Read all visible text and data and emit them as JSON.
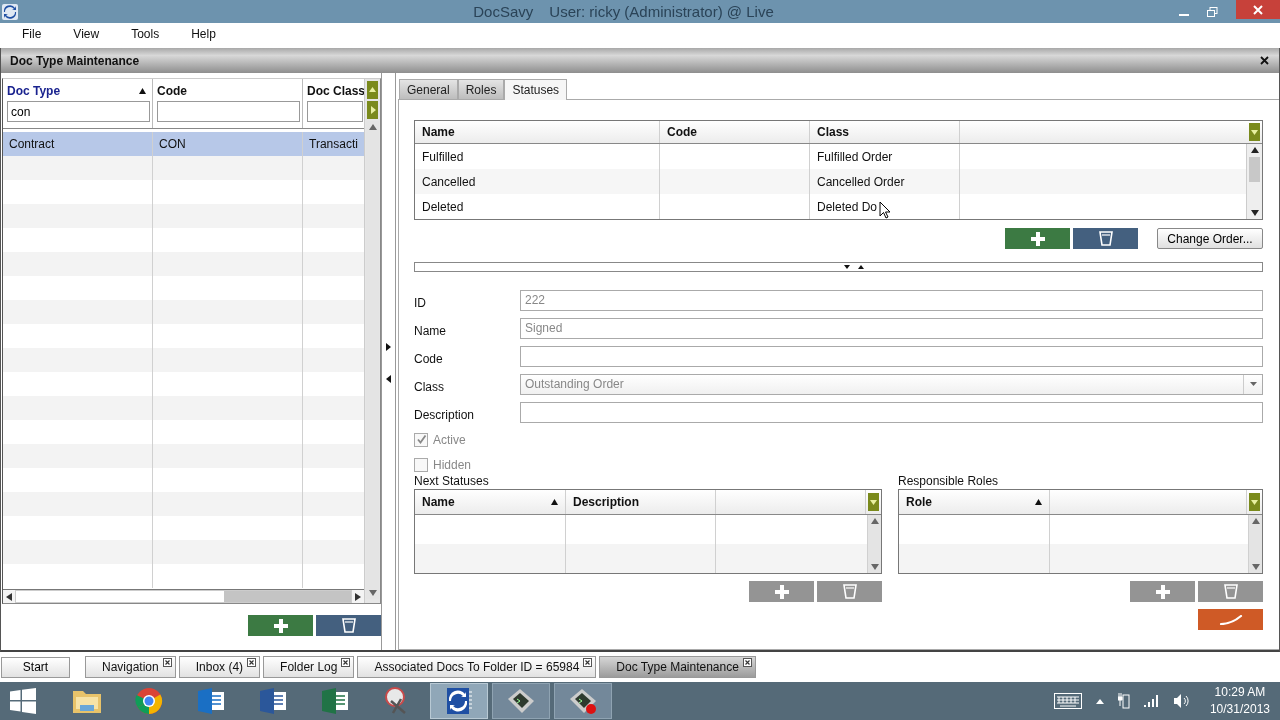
{
  "window": {
    "title": "DocSavy",
    "user": "User: ricky (Administrator) @ Live"
  },
  "menu": [
    "File",
    "View",
    "Tools",
    "Help"
  ],
  "panel": {
    "title": "Doc Type Maintenance"
  },
  "doc_types": {
    "columns": [
      {
        "label": "Doc Type",
        "sorted": true,
        "filter": "con"
      },
      {
        "label": "Code",
        "sorted": false
      },
      {
        "label": "Doc Class",
        "sorted": false
      }
    ],
    "rows": [
      {
        "cells": [
          "Contract",
          "CON",
          "Transacti"
        ],
        "selected": true
      }
    ],
    "actions_enabled": true
  },
  "tabs": [
    {
      "label": "General",
      "selected": false
    },
    {
      "label": "Roles",
      "selected": false
    },
    {
      "label": "Statuses",
      "selected": true
    }
  ],
  "statuses": {
    "columns": [
      "Name",
      "Code",
      "Class"
    ],
    "rows": [
      {
        "name": "Fulfilled",
        "class": "Fulfilled Order"
      },
      {
        "name": "Cancelled",
        "class": "Cancelled Order"
      },
      {
        "name": "Deleted",
        "class": "Deleted Do"
      }
    ],
    "actions_enabled": true,
    "change_order": "Change Order..."
  },
  "form": {
    "fields": [
      {
        "label": "ID",
        "value": "222",
        "kind": "text"
      },
      {
        "label": "Name",
        "value": "Signed",
        "kind": "text"
      },
      {
        "label": "Code",
        "kind": "text"
      },
      {
        "label": "Class",
        "value": "Outstanding Order",
        "kind": "select"
      },
      {
        "label": "Description",
        "kind": "text"
      }
    ],
    "checkboxes": [
      {
        "label": "Active",
        "checked": true
      },
      {
        "label": "Hidden",
        "checked": false
      }
    ]
  },
  "next_statuses": {
    "title": "Next Statuses",
    "columns": [
      {
        "label": "Name",
        "sorted": true
      },
      {
        "label": "Description",
        "sorted": false
      }
    ],
    "actions_enabled": false
  },
  "responsible_roles": {
    "title": "Responsible Roles",
    "columns": [
      {
        "label": "Role",
        "sorted": true
      }
    ],
    "actions_enabled": false
  },
  "doc_tabs": {
    "start": "Start",
    "tabs": [
      {
        "label": "Navigation",
        "selected": false
      },
      {
        "label": "Inbox (4)",
        "selected": false
      },
      {
        "label": "Folder Log",
        "selected": false
      },
      {
        "label": "Associated Docs To Folder ID = 65984",
        "selected": false
      },
      {
        "label": "Doc Type Maintenance",
        "selected": true
      }
    ]
  },
  "taskbar": {
    "apps": [
      {
        "kind": "explorer",
        "active": false,
        "running": false
      },
      {
        "kind": "chrome",
        "active": false,
        "running": false
      },
      {
        "kind": "outlook",
        "active": false,
        "running": false
      },
      {
        "kind": "word",
        "active": false,
        "running": false
      },
      {
        "kind": "excel",
        "active": false,
        "running": false
      },
      {
        "kind": "snipping",
        "active": false,
        "running": false
      },
      {
        "kind": "docsavy",
        "active": true,
        "running": true
      },
      {
        "kind": "terminal",
        "active": false,
        "running": true
      },
      {
        "kind": "terminal-alert",
        "active": false,
        "running": true
      }
    ],
    "time": "10:29 AM",
    "date": "10/31/2013"
  }
}
